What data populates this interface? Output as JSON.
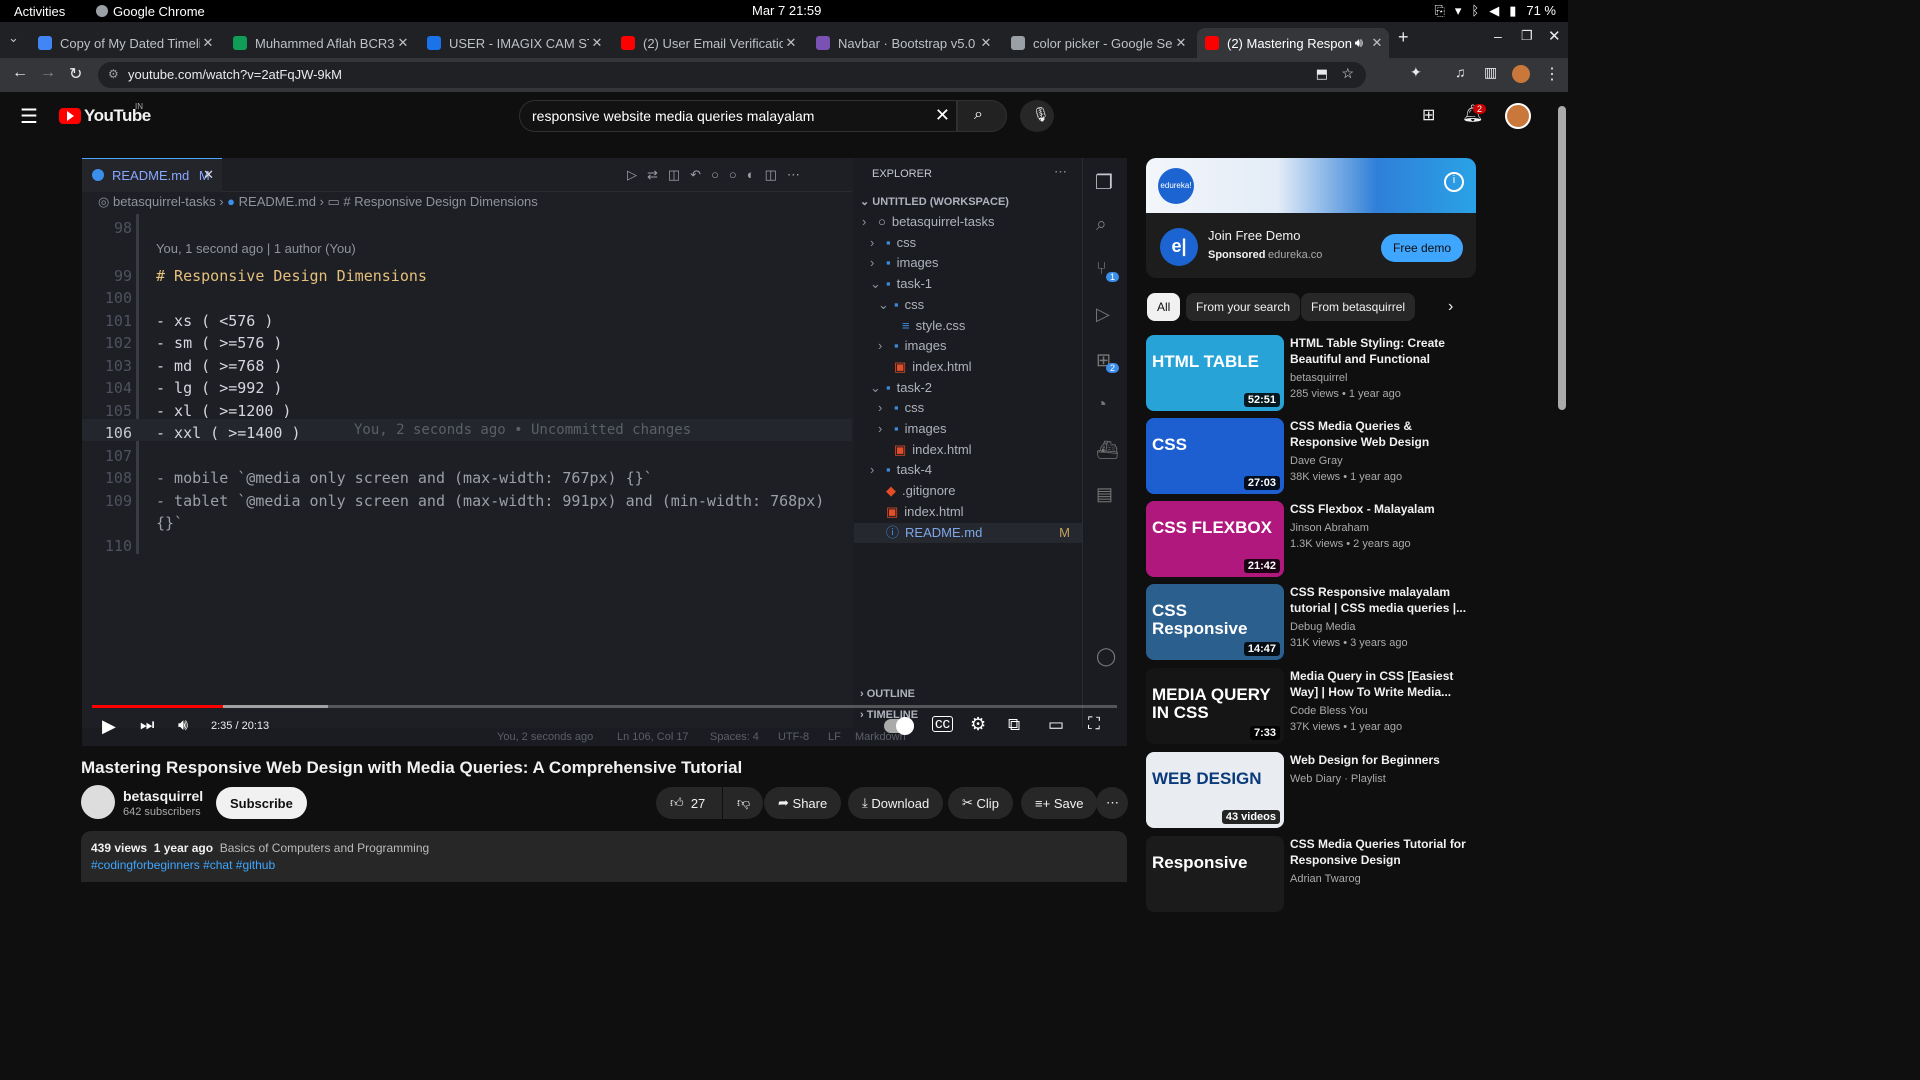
{
  "system": {
    "activities": "Activities",
    "app": "Google Chrome",
    "clock": "Mar 7  21:59",
    "battery": "71 %"
  },
  "tabs": [
    {
      "title": "Copy of My Dated Timeli",
      "color": "#4285f4"
    },
    {
      "title": "Muhammed Aflah BCR3",
      "color": "#0f9d58"
    },
    {
      "title": "USER - IMAGIX CAM STO",
      "color": "#1a73e8"
    },
    {
      "title": "(2) User Email Verificatio",
      "color": "#ff0000"
    },
    {
      "title": "Navbar · Bootstrap v5.0",
      "color": "#7952b3"
    },
    {
      "title": "color picker - Google Sea",
      "color": "#9aa0a6"
    },
    {
      "title": "(2) Mastering Respon",
      "color": "#ff0000"
    }
  ],
  "url": "youtube.com/watch?v=2atFqJW-9kM",
  "yt": {
    "logo": "YouTube",
    "region": "IN",
    "search_value": "responsive website media queries malayalam",
    "notif_count": "2"
  },
  "editor": {
    "tab": "README.md",
    "tab_status": "M",
    "breadcrumb": [
      "betasquirrel-tasks",
      "README.md",
      "# Responsive Design Dimensions"
    ],
    "blame": "You, 1 second ago | 1 author (You)",
    "lines": [
      {
        "n": "98",
        "t": ""
      },
      {
        "n": "99",
        "t": "# Responsive Design Dimensions"
      },
      {
        "n": "100",
        "t": ""
      },
      {
        "n": "101",
        "t": "- xs ( <576 )"
      },
      {
        "n": "102",
        "t": "- sm ( >=576 )"
      },
      {
        "n": "103",
        "t": "- md ( >=768 )"
      },
      {
        "n": "104",
        "t": "- lg ( >=992 )"
      },
      {
        "n": "105",
        "t": "- xl ( >=1200 )"
      },
      {
        "n": "106",
        "t": "- xxl ( >=1400 )"
      },
      {
        "n": "107",
        "t": ""
      },
      {
        "n": "108",
        "t": "- mobile `@media only screen and (max-width: 767px) {}`"
      },
      {
        "n": "109",
        "t": "- tablet `@media only screen and (max-width: 991px) and (min-width: 768px)"
      },
      {
        "n": "",
        "t": "{}`"
      },
      {
        "n": "110",
        "t": ""
      }
    ],
    "inline_blame": "You, 2 seconds ago • Uncommitted changes",
    "status": [
      "You, 2 seconds ago",
      "Ln 106, Col 17",
      "Spaces: 4",
      "UTF-8",
      "LF",
      "Markdown"
    ]
  },
  "explorer": {
    "header": "EXPLORER",
    "workspace": "UNTITLED (WORKSPACE)",
    "items": [
      {
        "label": "betasquirrel-tasks",
        "depth": 1,
        "kind": "root"
      },
      {
        "label": "css",
        "depth": 2,
        "kind": "folder"
      },
      {
        "label": "images",
        "depth": 2,
        "kind": "folder"
      },
      {
        "label": "task-1",
        "depth": 2,
        "kind": "folder-open"
      },
      {
        "label": "css",
        "depth": 3,
        "kind": "folder-open"
      },
      {
        "label": "style.css",
        "depth": 4,
        "kind": "css"
      },
      {
        "label": "images",
        "depth": 3,
        "kind": "folder"
      },
      {
        "label": "index.html",
        "depth": 3,
        "kind": "html"
      },
      {
        "label": "task-2",
        "depth": 2,
        "kind": "folder-open"
      },
      {
        "label": "css",
        "depth": 3,
        "kind": "folder"
      },
      {
        "label": "images",
        "depth": 3,
        "kind": "folder"
      },
      {
        "label": "index.html",
        "depth": 3,
        "kind": "html"
      },
      {
        "label": "task-4",
        "depth": 2,
        "kind": "folder"
      },
      {
        "label": ".gitignore",
        "depth": 2,
        "kind": "git"
      },
      {
        "label": "index.html",
        "depth": 2,
        "kind": "html"
      },
      {
        "label": "README.md",
        "depth": 2,
        "kind": "md",
        "badge": "M"
      }
    ],
    "outline": "OUTLINE",
    "timeline": "TIMELINE"
  },
  "activity_badges": [
    "1",
    "2"
  ],
  "player": {
    "time": "2:35 / 20:13",
    "progress": 0.128,
    "buffered": 0.23
  },
  "video": {
    "title": "Mastering Responsive Web Design with Media Queries: A Comprehensive Tutorial",
    "channel": "betasquirrel",
    "subs": "642 subscribers",
    "subscribe": "Subscribe",
    "likes": "27",
    "share": "Share",
    "download": "Download",
    "clip": "Clip",
    "save": "Save",
    "views": "439 views",
    "age": "1 year ago",
    "category": "Basics of Computers and Programming",
    "tags": "#codingforbeginners #chat #github"
  },
  "ad": {
    "brand": "edureka!",
    "headline": "Join Free Demo",
    "sponsored": "Sponsored",
    "domain": "edureka.co",
    "cta": "Free demo"
  },
  "chips": [
    "All",
    "From your search",
    "From betasquirrel"
  ],
  "recs": [
    {
      "title": "HTML Table Styling: Create Beautiful and Functional Tables",
      "channel": "betasquirrel",
      "meta": "285 views • 1 year ago",
      "duration": "52:51",
      "thumb_text": "HTML TABLE",
      "bg": "#28a3d8"
    },
    {
      "title": "CSS Media Queries & Responsive Web Design tutori...",
      "channel": "Dave Gray",
      "meta": "38K views • 1 year ago",
      "duration": "27:03",
      "thumb_text": "CSS",
      "bg": "#1d5fd0"
    },
    {
      "title": "CSS Flexbox - Malayalam",
      "channel": "Jinson Abraham",
      "meta": "1.3K views • 2 years ago",
      "duration": "21:42",
      "thumb_text": "CSS FLEXBOX",
      "bg": "#b0187e"
    },
    {
      "title": "CSS Responsive malayalam tutorial | CSS media queries |...",
      "channel": "Debug Media",
      "meta": "31K views • 3 years ago",
      "duration": "14:47",
      "thumb_text": "CSS Responsive",
      "bg": "#2b5f8e"
    },
    {
      "title": "Media Query in CSS [Easiest Way] | How To Write Media...",
      "channel": "Code Bless You",
      "meta": "37K views • 1 year ago",
      "duration": "7:33",
      "thumb_text": "MEDIA QUERY IN CSS",
      "bg": "#151515"
    },
    {
      "title": "Web Design for Beginners",
      "channel": "Web Diary · Playlist",
      "meta": "",
      "duration": "43 videos",
      "thumb_text": "WEB DESIGN",
      "bg": "#e9edf2"
    },
    {
      "title": "CSS Media Queries Tutorial for Responsive Design",
      "channel": "Adrian Twarog",
      "meta": "",
      "duration": "",
      "thumb_text": "Responsive",
      "bg": "#1b1b1b"
    }
  ]
}
